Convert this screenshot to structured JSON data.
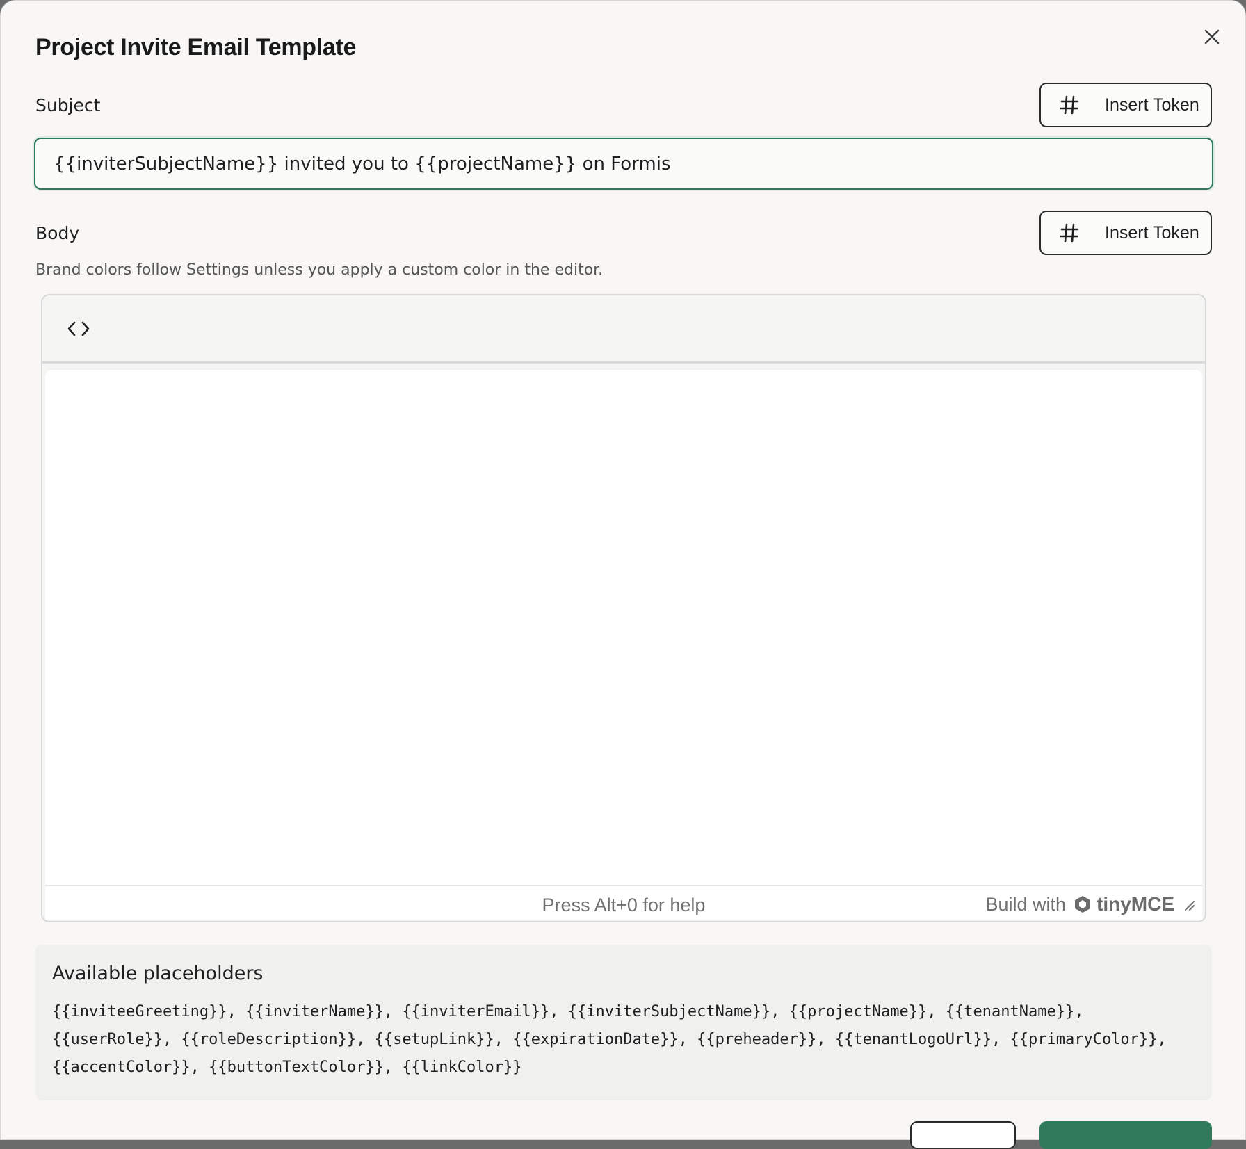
{
  "dialog": {
    "title": "Project Invite Email Template",
    "close_icon": "close-icon"
  },
  "subject": {
    "label": "Subject",
    "insert_token_label": "Insert Token",
    "insert_token_icon": "hash-icon",
    "value": "{{inviterSubjectName}} invited you to {{projectName}} on Formis"
  },
  "body": {
    "label": "Body",
    "insert_token_label": "Insert Token",
    "insert_token_icon": "hash-icon",
    "helper_text": "Brand colors follow Settings unless you apply a custom color in the editor."
  },
  "editor": {
    "toolbar_icon": "code-icon",
    "help_text": "Press Alt+0 for help",
    "brand_prefix": "Build with",
    "brand_name": "tinyMCE",
    "resize_icon": "resize-handle-icon"
  },
  "placeholders": {
    "title": "Available placeholders",
    "list": "{{inviteeGreeting}}, {{inviterName}}, {{inviterEmail}}, {{inviterSubjectName}}, {{projectName}}, {{tenantName}}, {{userRole}}, {{roleDescription}}, {{setupLink}}, {{expirationDate}}, {{preheader}}, {{tenantLogoUrl}}, {{primaryColor}}, {{accentColor}}, {{buttonTextColor}}, {{linkColor}}"
  },
  "colors": {
    "accent": "#2f7a5a",
    "background": "#f8f7f5",
    "text": "#1f1f1f"
  }
}
